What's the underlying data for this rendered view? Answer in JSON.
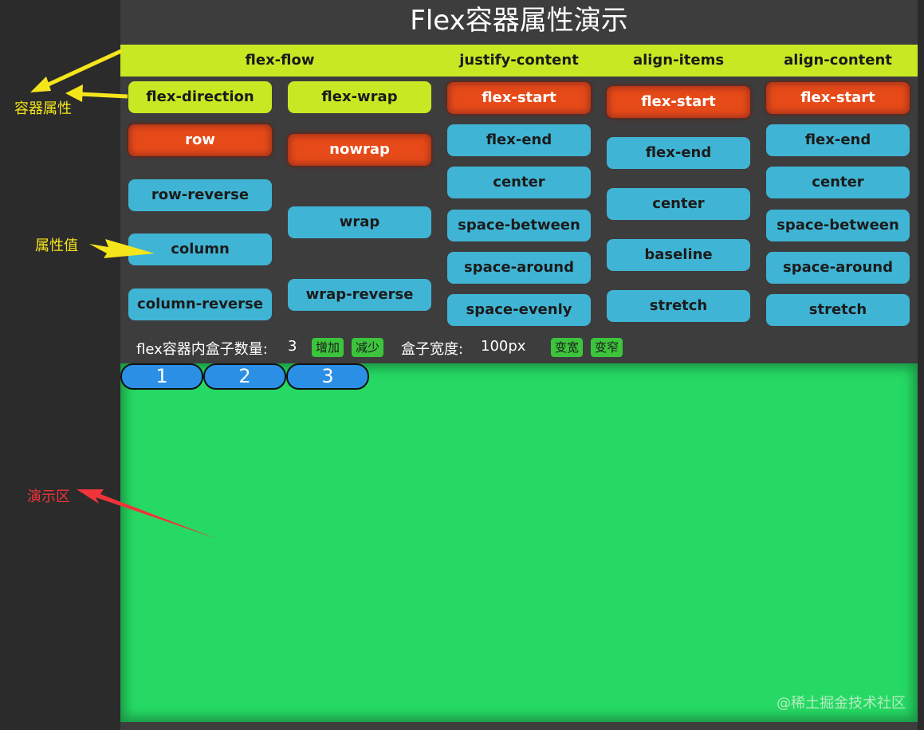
{
  "title": "Flex容器属性演示",
  "headers": [
    "flex-flow",
    "justify-content",
    "align-items",
    "align-content"
  ],
  "flex_flow": {
    "direction_label": "flex-direction",
    "wrap_label": "flex-wrap",
    "direction_values": [
      "row",
      "row-reverse",
      "column",
      "column-reverse"
    ],
    "wrap_values": [
      "nowrap",
      "wrap",
      "wrap-reverse"
    ]
  },
  "justify_content": [
    "flex-start",
    "flex-end",
    "center",
    "space-between",
    "space-around",
    "space-evenly"
  ],
  "align_items": [
    "flex-start",
    "flex-end",
    "center",
    "baseline",
    "stretch"
  ],
  "align_content": [
    "flex-start",
    "flex-end",
    "center",
    "space-between",
    "space-around",
    "stretch"
  ],
  "controls": {
    "count_label": "flex容器内盒子数量:",
    "count_value": "3",
    "increase": "增加",
    "decrease": "减少",
    "width_label": "盒子宽度:",
    "width_value": "100px",
    "wider": "变宽",
    "narrower": "变窄"
  },
  "boxes": [
    "1",
    "2",
    "3"
  ],
  "annotations": {
    "container_props": "容器属性",
    "prop_values": "属性值",
    "demo_area": "演示区"
  },
  "watermark": "@稀土掘金技术社区",
  "colors": {
    "accent": "#c8e823",
    "value_button": "#40b4d4",
    "active_button": "#e64a19",
    "demo_bg": "#26d964",
    "box": "#2b8fe6",
    "small_button": "#3cc43c",
    "annot_yellow": "#f5e51b",
    "annot_red": "#f0343a"
  }
}
